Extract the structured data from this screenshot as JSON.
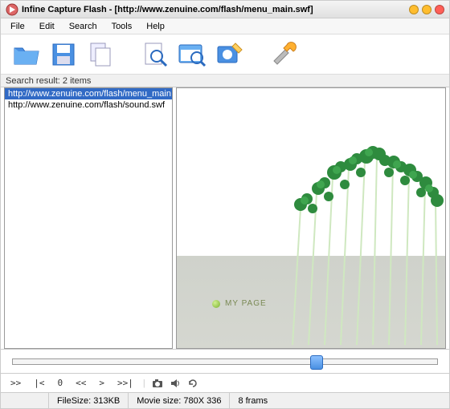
{
  "window": {
    "title": "Infine Capture Flash - [http://www.zenuine.com/flash/menu_main.swf]"
  },
  "menu": {
    "file": "File",
    "edit": "Edit",
    "search": "Search",
    "tools": "Tools",
    "help": "Help"
  },
  "search": {
    "label": "Search result: 2 items",
    "items": [
      "http://www.zenuine.com/flash/menu_main.swf",
      "http://www.zenuine.com/flash/sound.swf"
    ]
  },
  "preview": {
    "mypage_label": "MY PAGE"
  },
  "playbar": {
    "first": ">>",
    "prev": "|<",
    "stop": "0",
    "step_back": "<<",
    "play": ">",
    "step_fwd": ">>|"
  },
  "status": {
    "filesize_label": "FileSize: 313KB",
    "moviesize_label": "Movie size: 780X 336",
    "frames_label": "8 frams"
  }
}
